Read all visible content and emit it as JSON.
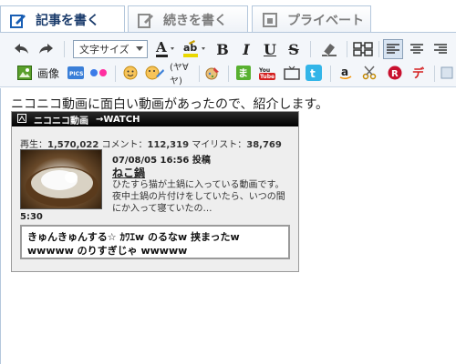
{
  "tabs": [
    {
      "label": "記事を書く",
      "icon": "pencil-icon",
      "active": true
    },
    {
      "label": "続きを書く",
      "icon": "edit-note-icon",
      "active": false
    },
    {
      "label": "プライベート",
      "icon": "lock-page-icon",
      "active": false
    }
  ],
  "toolbar": {
    "font_size_select": "文字サイズ",
    "bold": "B",
    "italic": "I",
    "underline": "U",
    "strike": "S",
    "image_label": "画像",
    "emoticon_text": "(ヤ∀ヤ)"
  },
  "editor": {
    "intro": "ニコニコ動画に面白い動画があったので、紹介します。"
  },
  "nico": {
    "brand": "ニコニコ動画",
    "watch": "→WATCH",
    "stats_views_label": "再生：",
    "stats_views": "1,570,022",
    "stats_comments_label": "コメント：",
    "stats_comments": "112,319",
    "stats_mylist_label": "マイリスト：",
    "stats_mylist": "38,769",
    "date": "07/08/05 16:56 投稿",
    "title": "ねこ鍋",
    "description": "ひたすら猫が土鍋に入っている動画です。夜中土鍋の片付けをしていたら、いつの間にか入って寝ていたの…",
    "duration": "5:30",
    "comment_line1": "きゅんきゅんする☆ ｶﾜｴw のるなw 挟まったw",
    "comment_line2": "wwwww のりすぎじゃ wwwww"
  },
  "colors": {
    "tab_active_text": "#1a3b6b",
    "tab_inactive_text": "#7c7c7c",
    "border_blue": "#b4c7dc"
  }
}
